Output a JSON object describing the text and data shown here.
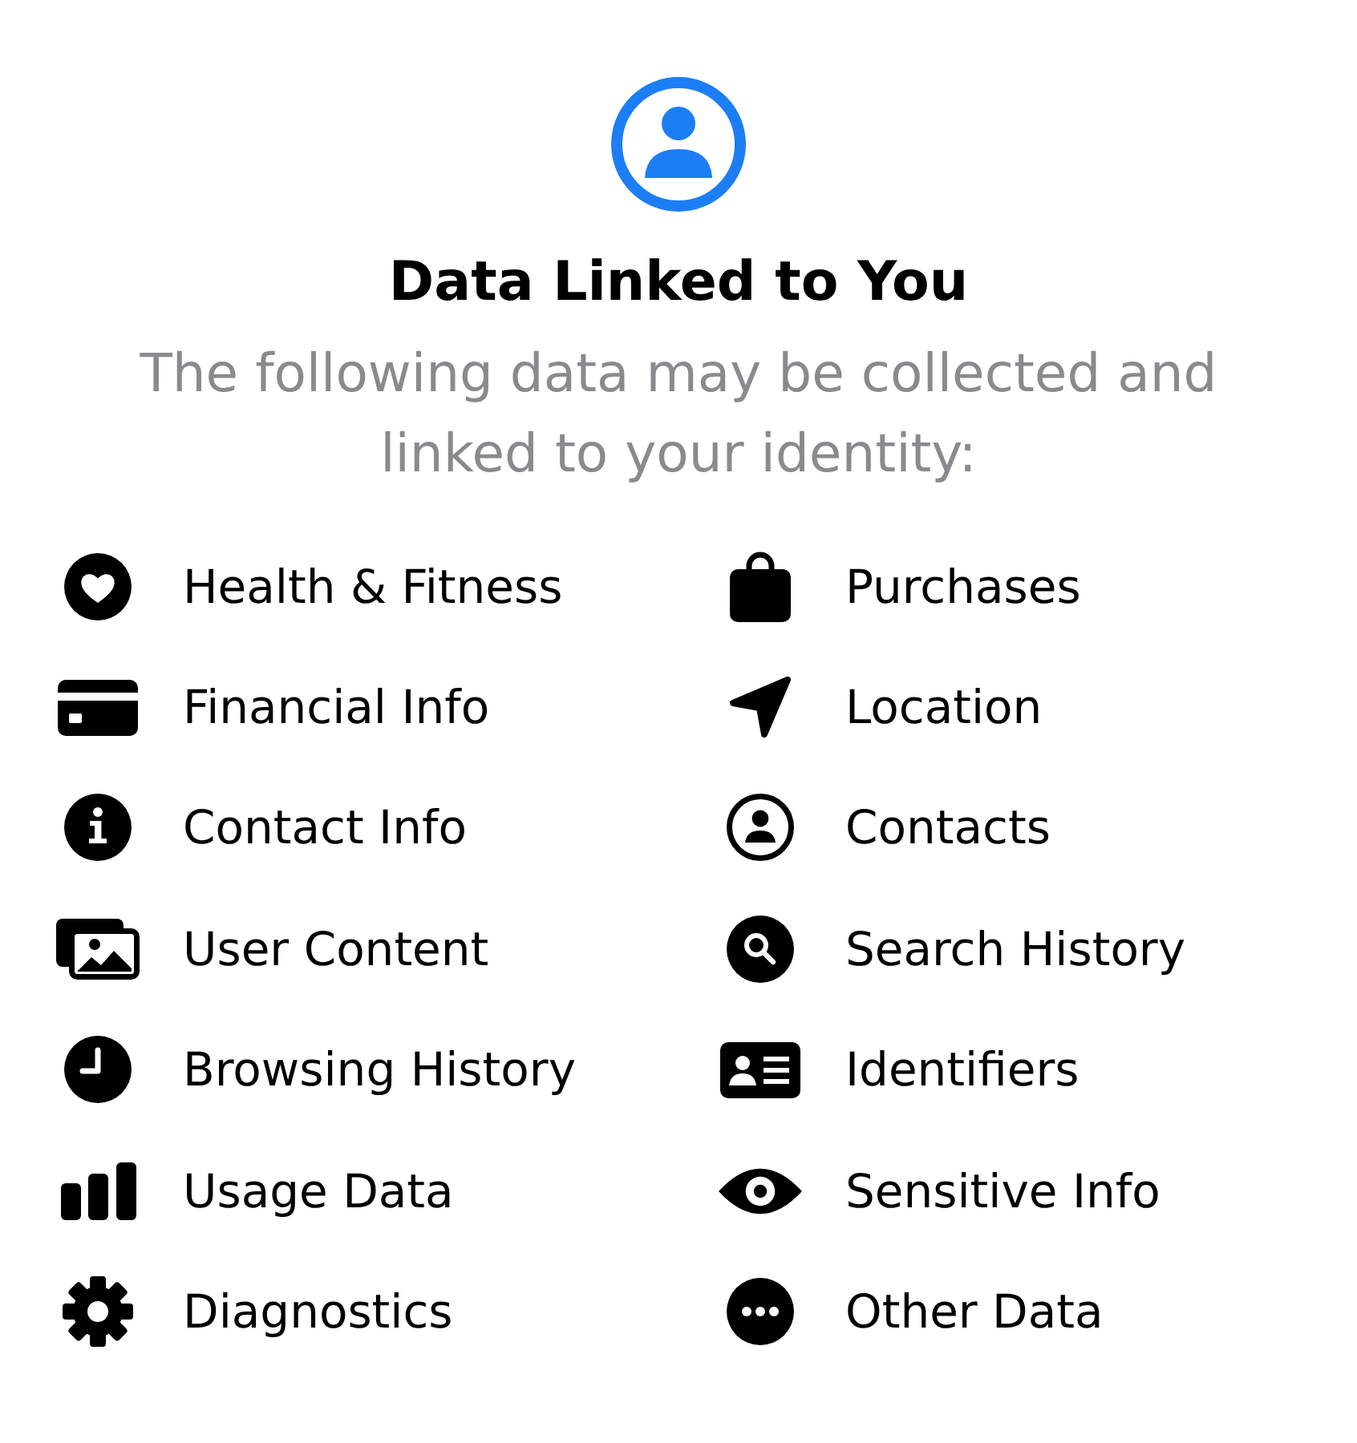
{
  "header": {
    "title": "Data Linked to You",
    "subtitle": "The following data may be collected and linked to your identity:"
  },
  "items": [
    "Health & Fitness",
    "Purchases",
    "Financial Info",
    "Location",
    "Contact Info",
    "Contacts",
    "User Content",
    "Search History",
    "Browsing History",
    "Identifiers",
    "Usage Data",
    "Sensitive Info",
    "Diagnostics",
    "Other Data"
  ]
}
